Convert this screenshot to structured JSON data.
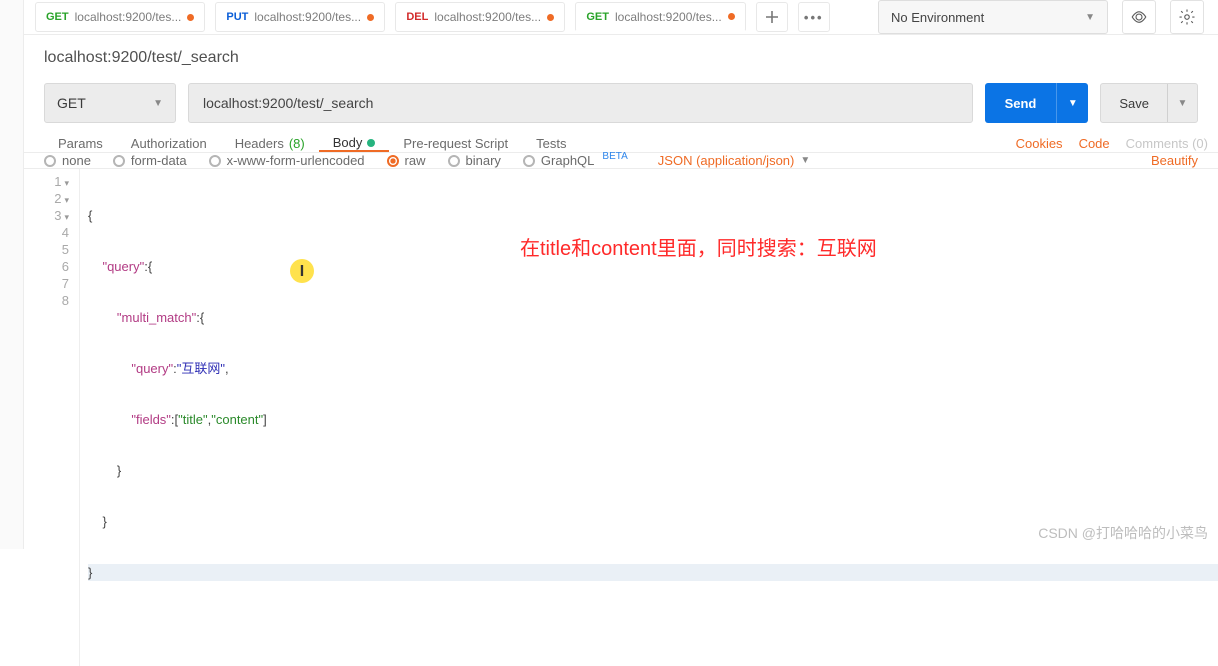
{
  "topbar": {
    "tabs": [
      {
        "method": "GET",
        "method_class": "m-get",
        "label": "localhost:9200/tes...",
        "dirty": true,
        "active": false
      },
      {
        "method": "PUT",
        "method_class": "m-put",
        "label": "localhost:9200/tes...",
        "dirty": true,
        "active": false
      },
      {
        "method": "DEL",
        "method_class": "m-del",
        "label": "localhost:9200/tes...",
        "dirty": true,
        "active": false
      },
      {
        "method": "GET",
        "method_class": "m-get",
        "label": "localhost:9200/tes...",
        "dirty": true,
        "active": true
      }
    ],
    "env_label": "No Environment"
  },
  "request": {
    "title": "localhost:9200/test/_search",
    "method": "GET",
    "url": "localhost:9200/test/_search",
    "send_label": "Send",
    "save_label": "Save"
  },
  "section_tabs": {
    "params": "Params",
    "auth": "Authorization",
    "headers": "Headers",
    "headers_count": "(8)",
    "body": "Body",
    "prereq": "Pre-request Script",
    "tests": "Tests",
    "cookies": "Cookies",
    "code": "Code",
    "comments": "Comments (0)"
  },
  "body_types": {
    "none": "none",
    "form": "form-data",
    "xwww": "x-www-form-urlencoded",
    "raw": "raw",
    "binary": "binary",
    "graphql": "GraphQL",
    "beta": "BETA",
    "content_type": "JSON (application/json)",
    "beautify": "Beautify"
  },
  "editor": {
    "lines": [
      "1",
      "2",
      "3",
      "4",
      "5",
      "6",
      "7",
      "8"
    ],
    "code": {
      "l1": "{",
      "l2_key": "\"query\"",
      "l3_key": "\"multi_match\"",
      "l4_key": "\"query\"",
      "l4_val": "\"互联网\"",
      "l5_key": "\"fields\"",
      "l5_v1": "\"title\"",
      "l5_v2": "\"content\"",
      "l6": "        }",
      "l7": "    }",
      "l8": "}"
    },
    "annotation": "在title和content里面，同时搜索：互联网",
    "cursor_glyph": "I"
  },
  "watermark": "CSDN @打哈哈哈的小菜鸟"
}
